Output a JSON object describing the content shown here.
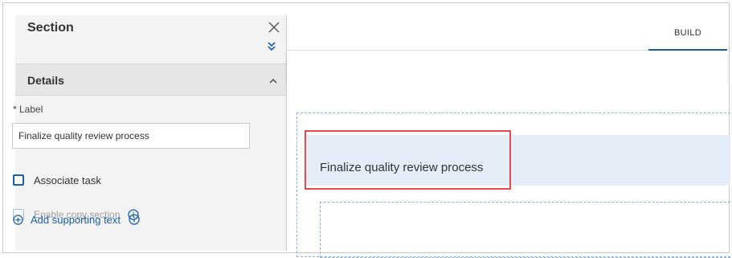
{
  "panel": {
    "title": "Section",
    "details_title": "Details",
    "label_field": {
      "label": "* Label",
      "value": "Finalize quality review process"
    },
    "associate_task_label": "Associate task",
    "enable_copy_label": "Enable copy section",
    "add_supporting_text_label": "Add supporting text"
  },
  "tabs": {
    "build_label": "BUILD"
  },
  "canvas": {
    "section_title": "Finalize quality review process"
  },
  "colors": {
    "accent": "#1a5ea8",
    "highlight": "#e8484f",
    "section_band": "#e4edf8",
    "panel_bg": "#f3f3f3"
  },
  "icons": [
    "close-icon",
    "expand-double-chevron-icon",
    "chevron-up-icon",
    "info-icon",
    "plus-circle-icon"
  ]
}
